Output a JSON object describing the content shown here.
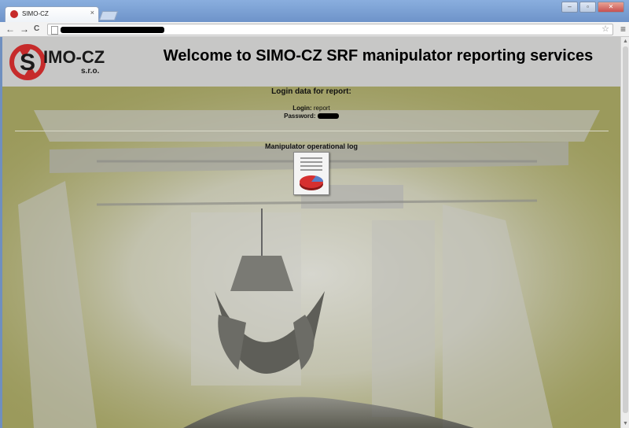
{
  "browser": {
    "tab_title": "SIMO-CZ",
    "tab_close_glyph": "×",
    "new_tab_icon": "new-tab-icon",
    "window_buttons": [
      "–",
      "▫",
      "✕"
    ],
    "nav": {
      "back": "←",
      "forward": "→",
      "reload": "C"
    },
    "bookmark_glyph": "☆",
    "menu_glyph": "≡",
    "scroll_up": "▲",
    "scroll_down": "▼"
  },
  "header": {
    "logo_text": "SIMO-CZ",
    "logo_sub": "s.r.o.",
    "title": "Welcome to SIMO-CZ SRF manipulator reporting services"
  },
  "login": {
    "title": "Login data for report:",
    "login_label": "Login:",
    "login_value": "report",
    "password_label": "Password:"
  },
  "report": {
    "title": "Manipulator operational log",
    "icon": "pie-chart-report-icon"
  },
  "colors": {
    "header_bg": "#c7c7c6",
    "body_bg": "#9b9a5c",
    "logo_red": "#c62b2b"
  }
}
